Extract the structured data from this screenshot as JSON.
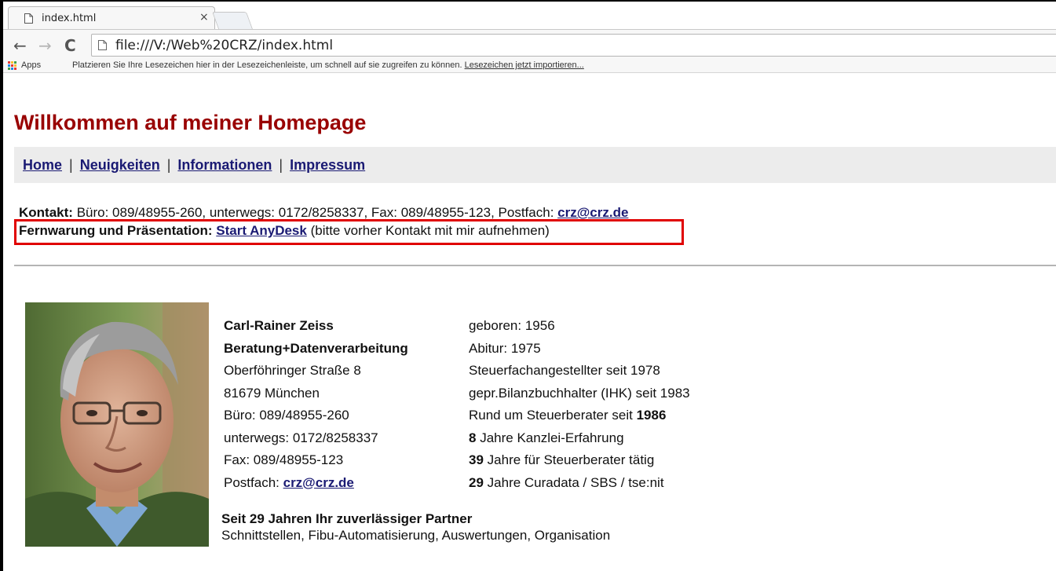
{
  "browser": {
    "tab_title": "index.html",
    "tab_close": "×",
    "url": "file:///V:/Web%20CRZ/index.html",
    "back": "←",
    "forward": "→",
    "reload": "C",
    "bookmarks": {
      "apps_label": "Apps",
      "hint": "Platzieren Sie Ihre Lesezeichen hier in der Lesezeichenleiste, um schnell auf sie zugreifen zu können.",
      "import_link": "Lesezeichen jetzt importieren..."
    }
  },
  "page": {
    "heading": "Willkommen auf meiner Homepage",
    "nav": [
      {
        "label": "Home"
      },
      {
        "label": "Neuigkeiten"
      },
      {
        "label": "Informationen"
      },
      {
        "label": "Impressum"
      }
    ],
    "nav_separator": "|",
    "contact": {
      "label": "Kontakt:",
      "text": "Büro: 089/48955-260, unterwegs: 0172/8258337, Fax: 089/48955-123, Postfach:",
      "email": "crz@crz.de"
    },
    "remote": {
      "label": "Fernwarung und Präsentation:",
      "link": "Start AnyDesk",
      "note": "(bitte vorher Kontakt mit mir aufnehmen)"
    },
    "profile": {
      "name": "Carl-Rainer Zeiss",
      "company": "Beratung+Datenverarbeitung",
      "street": "Oberföhringer Straße 8",
      "city": "81679 München",
      "office": "Büro: 089/48955-260",
      "mobile": "unterwegs: 0172/8258337",
      "fax": "Fax: 089/48955-123",
      "mail_label": "Postfach:",
      "mail": "crz@crz.de"
    },
    "facts": {
      "born": "geboren: 1956",
      "abitur": "Abitur: 1975",
      "steuer": "Steuerfachangestellter seit 1978",
      "bilanz": "gepr.Bilanzbuchhalter (IHK) seit 1983",
      "rund_text": "Rund um Steuerberater seit",
      "rund_year": "1986",
      "kanzlei_num": "8",
      "kanzlei_text": "Jahre Kanzlei-Erfahrung",
      "taetig_num": "39",
      "taetig_text": "Jahre für Steuerberater tätig",
      "curadata_num": "29",
      "curadata_text": "Jahre Curadata / SBS / tse:nit"
    },
    "partner": {
      "title": "Seit 29 Jahren Ihr zuverlässiger Partner",
      "text": "Schnittstellen, Fibu-Automatisierung, Auswertungen, Organisation"
    }
  },
  "colors": {
    "heading": "#990000",
    "link": "#1a1a73",
    "highlight_border": "#e00000",
    "navbar_bg": "#ececec"
  }
}
